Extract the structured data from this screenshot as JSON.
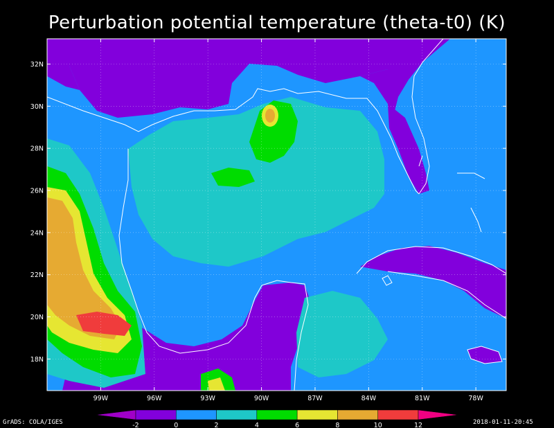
{
  "title": "Perturbation potential temperature (theta-t0) (K)",
  "footer": {
    "left": "GrADS: COLA/IGES",
    "right": "2018-01-11-20:45"
  },
  "axes": {
    "lat_labels": [
      {
        "text": "32N",
        "value": 32
      },
      {
        "text": "30N",
        "value": 30
      },
      {
        "text": "28N",
        "value": 28
      },
      {
        "text": "26N",
        "value": 26
      },
      {
        "text": "24N",
        "value": 24
      },
      {
        "text": "22N",
        "value": 22
      },
      {
        "text": "20N",
        "value": 20
      },
      {
        "text": "18N",
        "value": 18
      }
    ],
    "lon_labels": [
      {
        "text": "99W",
        "value": -99
      },
      {
        "text": "96W",
        "value": -96
      },
      {
        "text": "93W",
        "value": -93
      },
      {
        "text": "90W",
        "value": -90
      },
      {
        "text": "87W",
        "value": -87
      },
      {
        "text": "84W",
        "value": -84
      },
      {
        "text": "81W",
        "value": -81
      },
      {
        "text": "78W",
        "value": -78
      }
    ],
    "lon_range": [
      -102,
      -76.3
    ],
    "lat_range": [
      16.5,
      33.2
    ],
    "grid": "dotted"
  },
  "colorbar": {
    "colors": [
      "#a000c8",
      "#8200dc",
      "#1e96ff",
      "#1ec8c8",
      "#00dc00",
      "#e6e632",
      "#e6aa32",
      "#f03c3c",
      "#f00082"
    ],
    "labels": [
      "-2",
      "0",
      "2",
      "4",
      "6",
      "8",
      "10",
      "12"
    ]
  },
  "field": {
    "background": "#1e96ff",
    "palette": {
      "purple": "#8200dc",
      "blue": "#1e96ff",
      "cyan": "#1ec8c8",
      "green": "#00dc00",
      "yellow": "#e6e632",
      "orange": "#e6aa32",
      "red": "#f03c3c",
      "magenta": "#f00082",
      "coast": "#ffffff"
    }
  }
}
